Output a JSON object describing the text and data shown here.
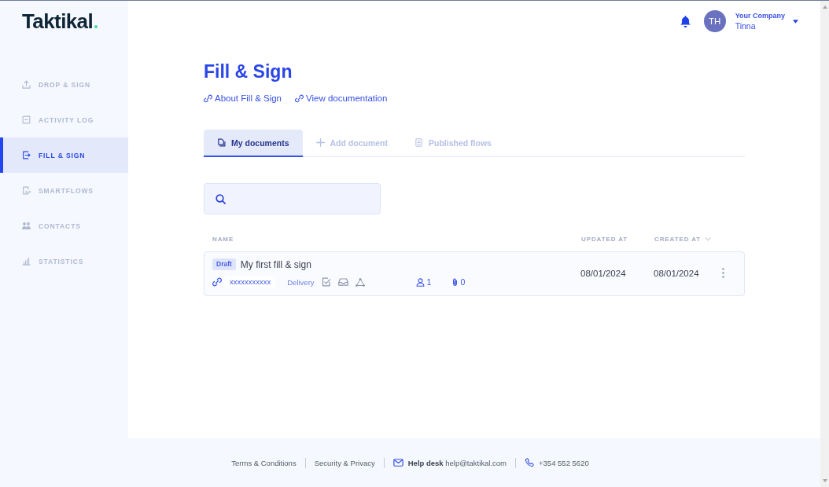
{
  "logo": {
    "text": "Taktikal"
  },
  "sidebar": {
    "items": [
      {
        "label": "DROP & SIGN",
        "selected": false
      },
      {
        "label": "ACTIVITY LOG",
        "selected": false
      },
      {
        "label": "FILL & SIGN",
        "selected": true
      },
      {
        "label": "SMARTFLOWS",
        "selected": false
      },
      {
        "label": "CONTACTS",
        "selected": false
      },
      {
        "label": "STATISTICS",
        "selected": false
      }
    ]
  },
  "header": {
    "user": {
      "initials": "TH",
      "company": "Your Company",
      "name": "Tinna"
    }
  },
  "page": {
    "title": "Fill & Sign",
    "links": [
      "About Fill & Sign",
      "View documentation"
    ]
  },
  "tabs": [
    {
      "label": "My documents",
      "selected": true
    },
    {
      "label": "Add document",
      "selected": false
    },
    {
      "label": "Published flows",
      "selected": false
    }
  ],
  "table": {
    "columns": [
      {
        "label": "NAME",
        "sorted": false
      },
      {
        "label": "UPDATED AT",
        "sorted": false
      },
      {
        "label": "CREATED AT",
        "sorted": true
      }
    ],
    "rows": [
      {
        "status": "Draft",
        "name": "My first fill & sign",
        "link": "xxxxxxxxxxx",
        "delivery": "Delivery",
        "signers": "1",
        "attachments": "0",
        "updated_at": "08/01/2024",
        "created_at": "08/01/2024"
      }
    ]
  },
  "footer": {
    "links": [
      "Terms & Conditions",
      "Security & Privacy"
    ],
    "help_desk": "**Help desk** help@taktikal.com",
    "phone": "+354 552 5620"
  }
}
